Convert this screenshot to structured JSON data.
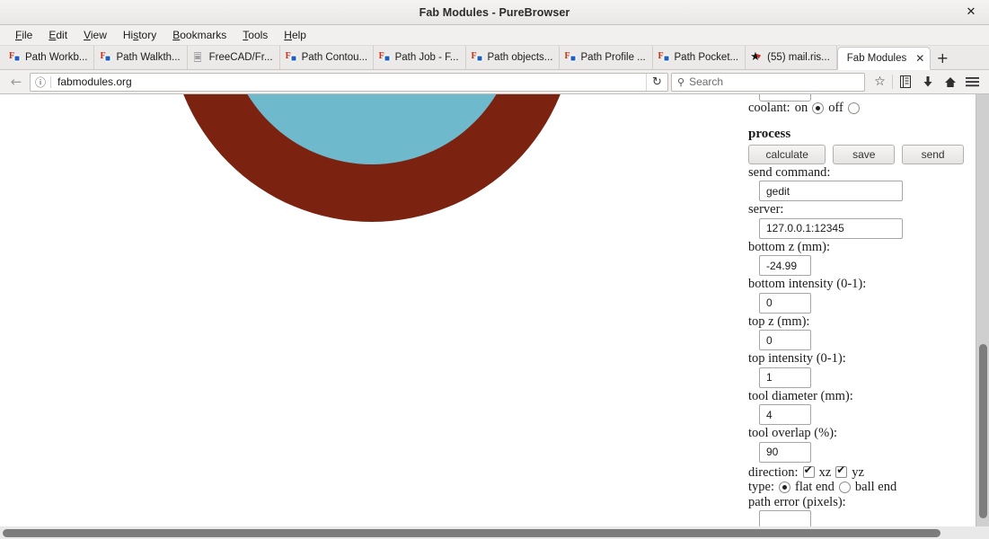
{
  "window": {
    "title": "Fab Modules - PureBrowser",
    "close_label": "✕"
  },
  "menubar": {
    "items": [
      {
        "pre": "",
        "accel": "F",
        "post": "ile"
      },
      {
        "pre": "",
        "accel": "E",
        "post": "dit"
      },
      {
        "pre": "",
        "accel": "V",
        "post": "iew"
      },
      {
        "pre": "Hi",
        "accel": "s",
        "post": "tory"
      },
      {
        "pre": "",
        "accel": "B",
        "post": "ookmarks"
      },
      {
        "pre": "",
        "accel": "T",
        "post": "ools"
      },
      {
        "pre": "",
        "accel": "H",
        "post": "elp"
      }
    ]
  },
  "tabs": {
    "items": [
      {
        "label": "Path Workb...",
        "icon": "freecad-favicon",
        "active": false
      },
      {
        "label": "Path Walkth...",
        "icon": "freecad-favicon",
        "active": false
      },
      {
        "label": "FreeCAD/Fr...",
        "icon": "document-favicon",
        "active": false
      },
      {
        "label": "Path Contou...",
        "icon": "freecad-favicon",
        "active": false
      },
      {
        "label": "Path Job - F...",
        "icon": "freecad-favicon",
        "active": false
      },
      {
        "label": "Path objects...",
        "icon": "freecad-favicon",
        "active": false
      },
      {
        "label": "Path Profile ...",
        "icon": "freecad-favicon",
        "active": false
      },
      {
        "label": "Path Pocket...",
        "icon": "freecad-favicon",
        "active": false
      },
      {
        "label": "(55) mail.ris...",
        "icon": "star-favicon",
        "active": false
      },
      {
        "label": "Fab Modules",
        "icon": "none",
        "active": true
      }
    ],
    "active_close_label": "✕",
    "new_tab_label": "+"
  },
  "navbar": {
    "back_label": "←",
    "identity_label": "ⓘ",
    "url": "fabmodules.org",
    "reload_label": "↻",
    "search_placeholder": "Search",
    "search_icon_label": "⚲",
    "bookmark_star_label": "☆",
    "library_label": "Ὅ6",
    "downloads_label": "↓",
    "home_label": "⌂",
    "menu_label": "≡"
  },
  "graphic": {
    "ring_color": "#7b2310",
    "core_color": "#6fb9cc"
  },
  "form": {
    "coolant": {
      "label": "coolant:",
      "on_label": "on",
      "off_label": "off",
      "selected": "on"
    },
    "process_heading": "process",
    "buttons": {
      "calculate": "calculate",
      "save": "save",
      "send": "send"
    },
    "send_command": {
      "label": "send command:",
      "value": "gedit"
    },
    "server": {
      "label": "server:",
      "value": "127.0.0.1:12345"
    },
    "bottom_z": {
      "label": "bottom z (mm):",
      "value": "-24.99"
    },
    "bottom_intensity": {
      "label": "bottom intensity (0-1):",
      "value": "0"
    },
    "top_z": {
      "label": "top z (mm):",
      "value": "0"
    },
    "top_intensity": {
      "label": "top intensity (0-1):",
      "value": "1"
    },
    "tool_diameter": {
      "label": "tool diameter (mm):",
      "value": "4"
    },
    "tool_overlap": {
      "label": "tool overlap (%):",
      "value": "90"
    },
    "direction": {
      "label": "direction:",
      "xz_label": "xz",
      "xz_checked": true,
      "yz_label": "yz",
      "yz_checked": true
    },
    "type": {
      "label": "type:",
      "flat_label": "flat end",
      "ball_label": "ball end",
      "selected": "flat end"
    },
    "path_error": {
      "label": "path error (pixels):"
    }
  }
}
